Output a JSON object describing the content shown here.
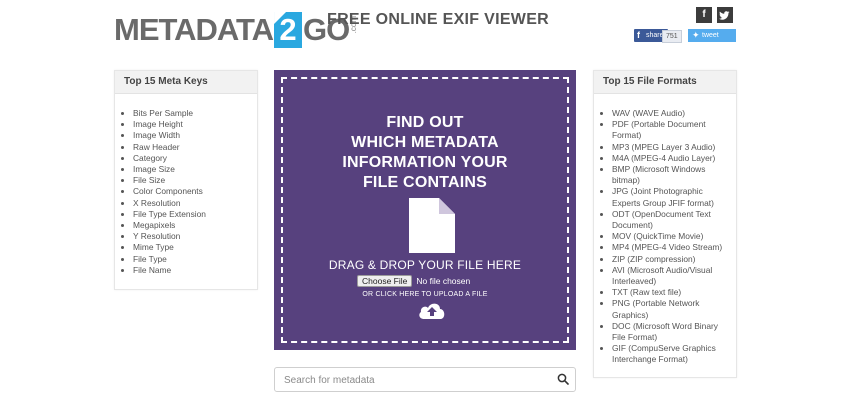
{
  "header": {
    "logo": {
      "part1": "METADATA",
      "part2": "2",
      "part3": "GO",
      "suffix": ".com"
    },
    "title": "FREE ONLINE EXIF VIEWER",
    "social": {
      "facebook_icon": "f",
      "twitter_icon": "twitter-bird",
      "share_label": "share",
      "share_count": "751",
      "tweet_label": "tweet"
    }
  },
  "left_panel": {
    "title": "Top 15 Meta Keys",
    "items": [
      "Bits Per Sample",
      "Image Height",
      "Image Width",
      "Raw Header",
      "Category",
      "Image Size",
      "File Size",
      "Color Components",
      "X Resolution",
      "File Type Extension",
      "Megapixels",
      "Y Resolution",
      "Mime Type",
      "File Type",
      "File Name"
    ]
  },
  "right_panel": {
    "title": "Top 15 File Formats",
    "items": [
      "WAV (WAVE Audio)",
      "PDF (Portable Document Format)",
      "MP3 (MPEG Layer 3 Audio)",
      "M4A (MPEG-4 Audio Layer)",
      "BMP (Microsoft Windows bitmap)",
      "JPG (Joint Photographic Experts Group JFIF format)",
      "ODT (OpenDocument Text Document)",
      "MOV (QuickTime Movie)",
      "MP4 (MPEG-4 Video Stream)",
      "ZIP (ZIP compression)",
      "AVI (Microsoft Audio/Visual Interleaved)",
      "TXT (Raw text file)",
      "PNG (Portable Network Graphics)",
      "DOC (Microsoft Word Binary File Format)",
      "GIF (CompuServe Graphics Interchange Format)"
    ]
  },
  "dropzone": {
    "heading_lines": [
      "FIND OUT",
      "WHICH METADATA",
      "INFORMATION YOUR",
      "FILE CONTAINS"
    ],
    "drag_text": "DRAG & DROP YOUR FILE HERE",
    "choose_file_label": "Choose File",
    "no_file_text": "No file chosen",
    "click_text": "OR CLICK HERE TO UPLOAD A FILE",
    "background_color": "#57417e"
  },
  "search": {
    "placeholder": "Search for metadata",
    "value": ""
  }
}
